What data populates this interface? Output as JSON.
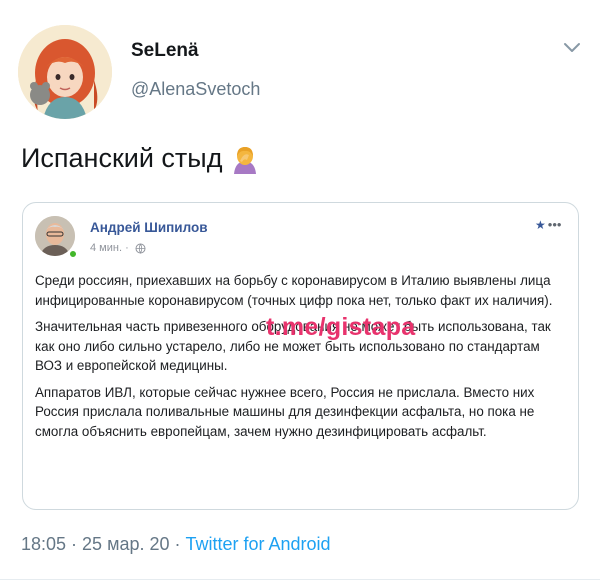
{
  "tweet": {
    "display_name": "SeLenä",
    "handle": "@AlenaSvetoch",
    "text": "Испанский стыд",
    "timestamp": "18:05 · 25 мар. 20 · ",
    "source": "Twitter for Android",
    "menu_icon": "chevron-down-icon",
    "emoji_icon": "woman-facepalming-icon"
  },
  "embedded_post": {
    "author": "Андрей Шипилов",
    "time": "4 мин. ·",
    "privacy_icon": "globe-icon",
    "menu_dots": "•••",
    "paragraphs": [
      "Среди россиян, приехавших на борьбу с коронавирусом в Италию выявлены лица инфицированные коронавирусом (точных цифр пока нет, только факт их наличия).",
      "Значительная часть привезенного оборудования не может быть использована, так как оно либо сильно устарело, либо не может быть использовано по стандартам ВОЗ и европейской медицины.",
      "Аппаратов ИВЛ, которые сейчас нужнее всего, Россия не прислала. Вместо них Россия прислала поливальные машины для дезинфекции асфальта, но пока не смогла объяснить европейцам, зачем нужно дезинфицировать асфальт."
    ]
  },
  "watermark": "t.me/gistapa",
  "colors": {
    "link": "#1da1f2",
    "fb_author": "#385898",
    "watermark": "#e8336d",
    "secondary_text": "#657786"
  }
}
